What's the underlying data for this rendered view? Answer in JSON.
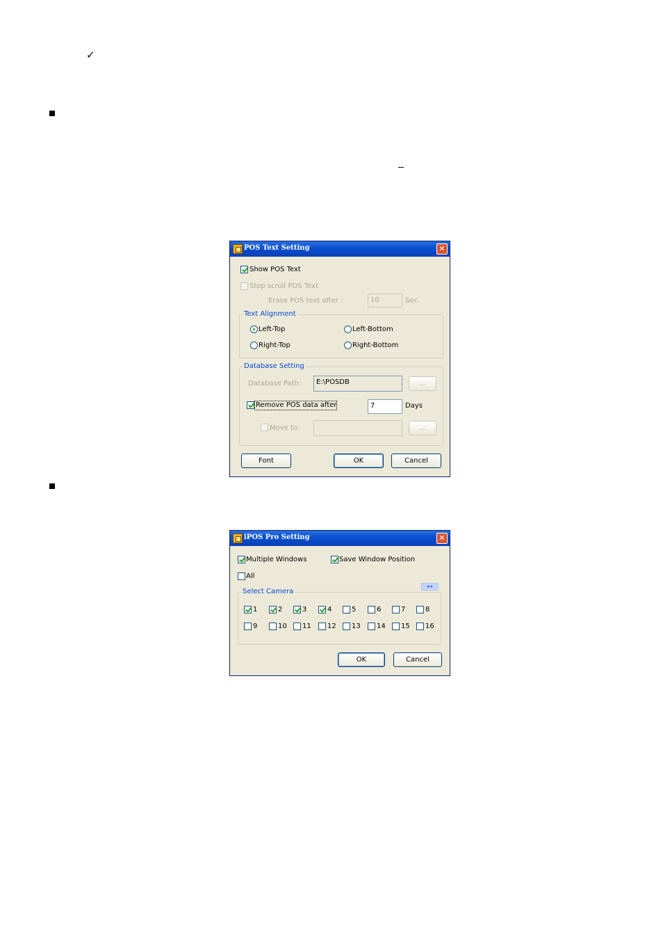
{
  "dialog1": {
    "title": "POS Text Setting",
    "close_glyph": "✕",
    "show_pos_text": {
      "label": "Show POS Text",
      "checked": true
    },
    "stop_scroll": {
      "label": "Stop scroll POS Text",
      "checked": false,
      "enabled": false
    },
    "erase_label": "Erase POS text after :",
    "erase_value": "10",
    "erase_unit": "Sec.",
    "text_alignment": {
      "title": "Text Alignment",
      "options": [
        "Left-Top",
        "Left-Bottom",
        "Right-Top",
        "Right-Bottom"
      ],
      "selected": "Left-Top"
    },
    "database": {
      "title": "Database Setting",
      "path_label": "Database Path:",
      "path_value": "E:\\POSDB",
      "browse_label": "...",
      "remove_label": "Remove POS data after",
      "remove_checked": true,
      "remove_value": "7",
      "remove_unit": "Days",
      "move_label": "Move to:",
      "move_value": "",
      "move_browse_label": "..."
    },
    "buttons": {
      "font": "Font",
      "ok": "OK",
      "cancel": "Cancel"
    }
  },
  "dialog2": {
    "title": "iPOS Pro Setting",
    "close_glyph": "✕",
    "multiple_windows": {
      "label": "Multiple Windows",
      "checked": true
    },
    "save_window_position": {
      "label": "Save Window Position",
      "checked": true
    },
    "all": {
      "label": "All",
      "checked": false
    },
    "scroll_glyphs": "◂ ▸",
    "select_camera": {
      "title": "Select Camera",
      "cameras": [
        "1",
        "2",
        "3",
        "4",
        "5",
        "6",
        "7",
        "8",
        "9",
        "10",
        "11",
        "12",
        "13",
        "14",
        "15",
        "16"
      ],
      "checked": [
        true,
        true,
        true,
        true,
        false,
        false,
        false,
        false,
        false,
        false,
        false,
        false,
        false,
        false,
        false,
        false
      ]
    },
    "buttons": {
      "ok": "OK",
      "cancel": "Cancel"
    }
  },
  "doc": {
    "check_mark": "✓"
  },
  "colors": {
    "title_bar": "#0a4fcf",
    "dialog_bg": "#ece9d8",
    "group_title": "#0046d5",
    "check": "#21a121",
    "close": "#d9542e"
  }
}
